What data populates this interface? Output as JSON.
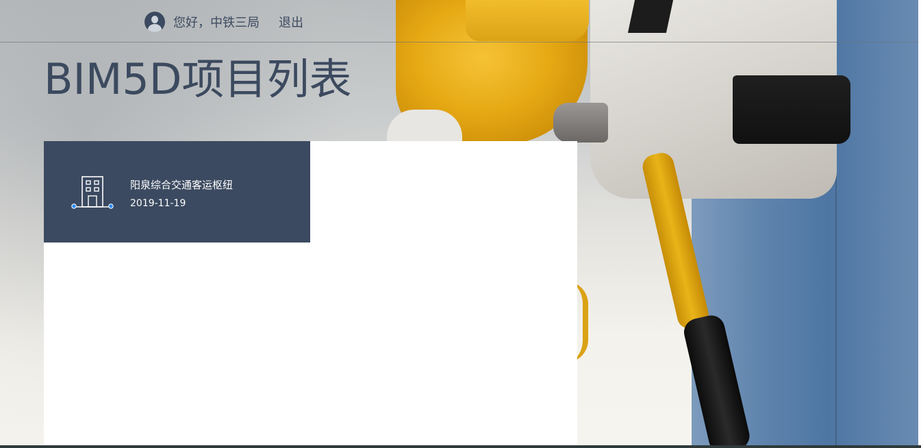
{
  "header": {
    "user_icon": "user-avatar-icon",
    "greeting": "您好，中铁三局",
    "logout_label": "退出"
  },
  "page": {
    "title": "BIM5D项目列表"
  },
  "projects": [
    {
      "icon": "building-icon",
      "name": "阳泉综合交通客运枢纽",
      "date": "2019-11-19"
    }
  ],
  "colors": {
    "primary_dark": "#3b4a60",
    "card_text": "#ffffff",
    "panel_bg": "#ffffff",
    "icon_accent": "#2d8cf0"
  }
}
